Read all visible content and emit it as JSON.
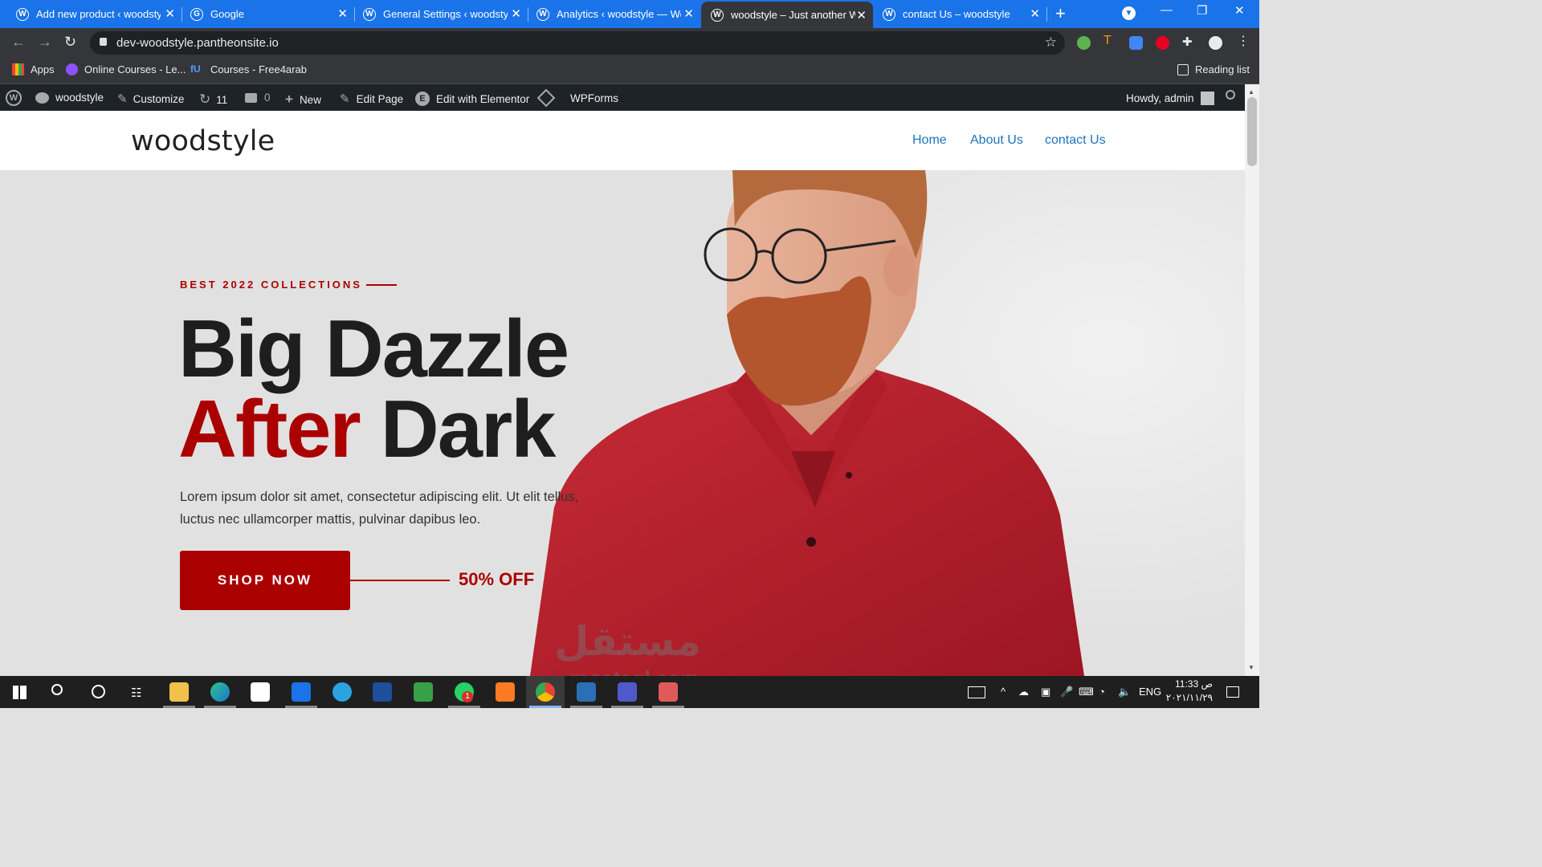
{
  "browser": {
    "tabs": [
      {
        "title": "Add new product ‹ woodsty",
        "active": false
      },
      {
        "title": "Google",
        "active": false
      },
      {
        "title": "General Settings ‹ woodsty",
        "active": false
      },
      {
        "title": "Analytics ‹ woodstyle — Wo",
        "active": false
      },
      {
        "title": "woodstyle – Just another W",
        "active": true
      },
      {
        "title": "contact Us – woodstyle",
        "active": false
      }
    ],
    "url": "dev-woodstyle.pantheonsite.io",
    "bookmarks": {
      "apps": "Apps",
      "online_courses": "Online Courses - Le...",
      "courses": "Courses - Free4arab",
      "reading_list": "Reading list"
    }
  },
  "admin_bar": {
    "site_name": "woodstyle",
    "customize": "Customize",
    "updates_count": "11",
    "comments_count": "0",
    "new_label": "New",
    "edit_page": "Edit Page",
    "edit_elementor": "Edit with Elementor",
    "wpforms": "WPForms",
    "howdy": "Howdy, admin"
  },
  "site": {
    "title": "woodstyle",
    "menu": [
      "Home",
      "About Us",
      "contact Us"
    ]
  },
  "hero": {
    "eyebrow": "BEST 2022 COLLECTIONS",
    "headline_line1": "Big Dazzle",
    "headline_red": "After",
    "headline_dark": " Dark",
    "lead": "Lorem ipsum dolor sit amet, consectetur adipiscing elit. Ut elit tellus, luctus nec ullamcorper mattis, pulvinar dapibus leo.",
    "cta": "SHOP NOW",
    "discount": "50% OFF"
  },
  "watermark": {
    "text": "مستقل",
    "sub": "mostaql.com"
  },
  "taskbar": {
    "language": "ENG",
    "time": "11:33 ص",
    "date": "٢٠٢١/١١/٢٩",
    "whatsapp_badge": "1"
  },
  "colors": {
    "tab_strip": "#1a73e8",
    "accent_red": "#aa0000",
    "admin_bar": "#1d2327",
    "link_blue": "#1e73be"
  }
}
